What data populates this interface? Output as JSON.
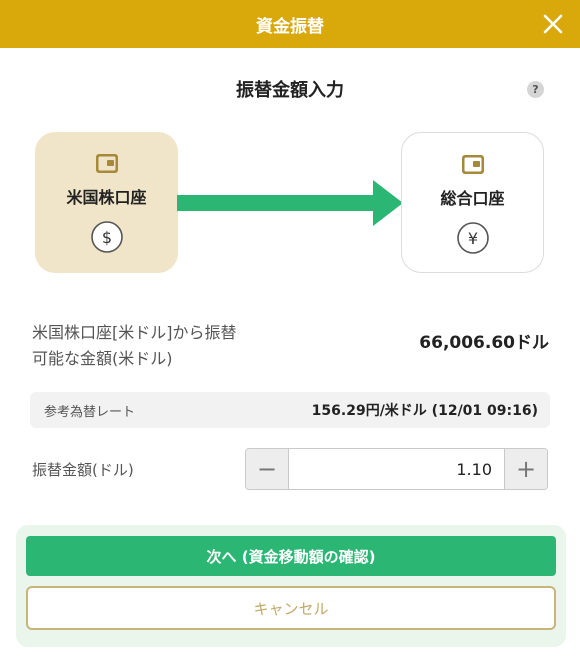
{
  "header": {
    "title": "資金振替"
  },
  "page_title": "振替金額入力",
  "help_label": "?",
  "from_account": {
    "name": "米国株口座",
    "currency_symbol": "$"
  },
  "to_account": {
    "name": "総合口座",
    "currency_symbol": "¥"
  },
  "available": {
    "label_line1": "米国株口座[米ドル]から振替",
    "label_line2": "可能な金額(米ドル)",
    "value": "66,006.60ドル"
  },
  "rate": {
    "label": "参考為替レート",
    "value": "156.29円/米ドル (12/01 09:16)"
  },
  "amount": {
    "label": "振替金額(ドル)",
    "value": "1.10",
    "minus": "−",
    "plus": "+"
  },
  "buttons": {
    "next": "次へ (資金移動額の確認)",
    "cancel": "キャンセル"
  },
  "colors": {
    "header": "#d9a80a",
    "accent_green": "#2bb673",
    "from_card": "#f0e5c8",
    "cancel_text": "#c2a96a"
  }
}
